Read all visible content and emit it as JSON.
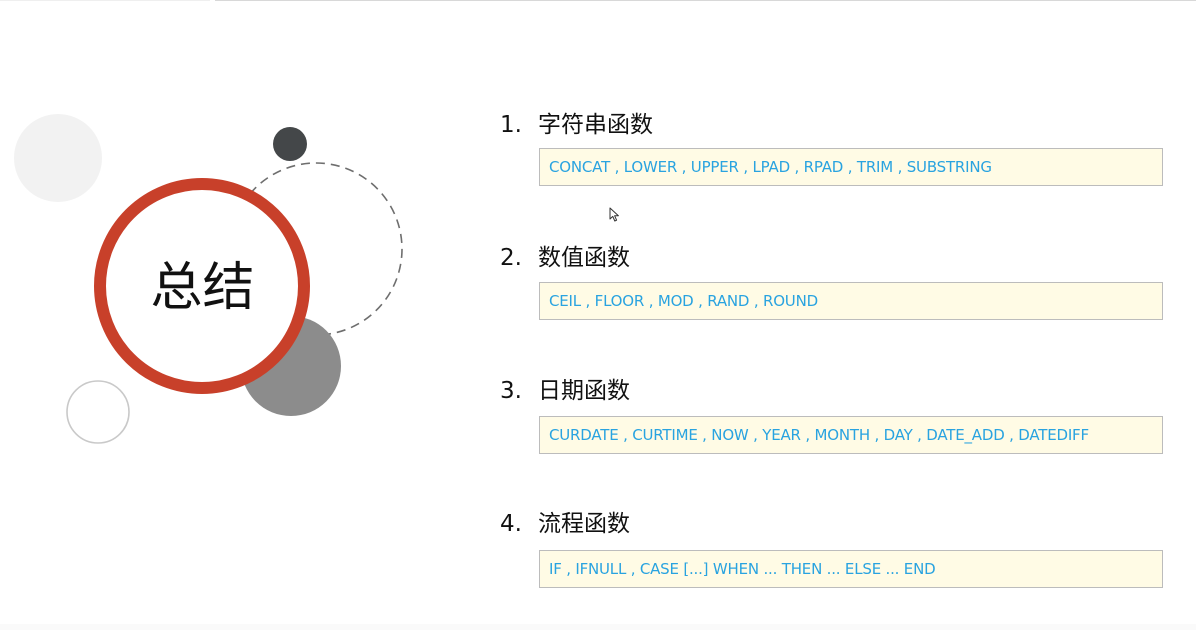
{
  "slide": {
    "title": "总结",
    "sections": [
      {
        "number": "1.",
        "heading": "字符串函数",
        "functions": "CONCAT , LOWER , UPPER , LPAD , RPAD , TRIM , SUBSTRING"
      },
      {
        "number": "2.",
        "heading": "数值函数",
        "functions": "CEIL , FLOOR , MOD , RAND , ROUND"
      },
      {
        "number": "3.",
        "heading": "日期函数",
        "functions": "CURDATE , CURTIME , NOW , YEAR , MONTH , DAY , DATE_ADD , DATEDIFF"
      },
      {
        "number": "4.",
        "heading": "流程函数",
        "functions": "IF  , IFNULL , CASE [...]  WHEN ...  THEN  ... ELSE ... END"
      }
    ]
  },
  "colors": {
    "ring": "#c8402a",
    "function_text": "#29a3e0",
    "code_box_bg": "#fffbe5"
  }
}
